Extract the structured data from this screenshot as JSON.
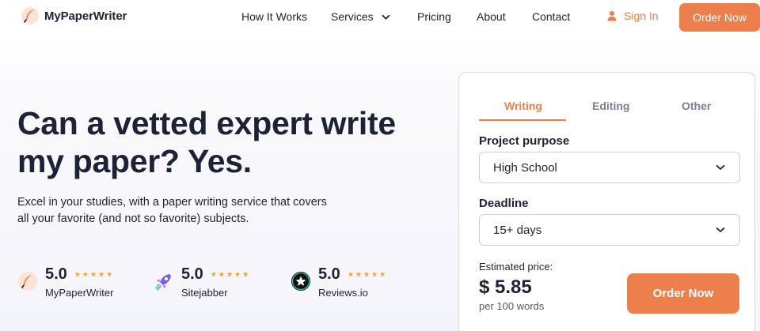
{
  "brand": {
    "name": "MyPaperWriter"
  },
  "nav": {
    "items": [
      {
        "label": "How It Works"
      },
      {
        "label": "Services"
      },
      {
        "label": "Pricing"
      },
      {
        "label": "About"
      },
      {
        "label": "Contact"
      }
    ],
    "signin_label": "Sign In",
    "order_label": "Order Now"
  },
  "hero": {
    "title": "Can a vetted expert write my paper? Yes.",
    "subtitle": "Excel in your studies, with a paper writing service that covers all your favorite (and not so favorite) subjects."
  },
  "ratings": [
    {
      "score": "5.0",
      "stars": 5,
      "name": "MyPaperWriter",
      "icon": "feather-logo-icon"
    },
    {
      "score": "5.0",
      "stars": 5,
      "name": "Sitejabber",
      "icon": "sitejabber-rocket-icon"
    },
    {
      "score": "5.0",
      "stars": 5,
      "name": "Reviews.io",
      "icon": "reviews-io-star-icon"
    }
  ],
  "calculator": {
    "tabs": [
      {
        "label": "Writing",
        "active": true
      },
      {
        "label": "Editing",
        "active": false
      },
      {
        "label": "Other",
        "active": false
      }
    ],
    "purpose_label": "Project purpose",
    "purpose_value": "High School",
    "deadline_label": "Deadline",
    "deadline_value": "15+ days",
    "estimate_label": "Estimated price:",
    "price": "$ 5.85",
    "price_unit": "per 100 words",
    "order_label": "Order Now"
  },
  "colors": {
    "accent": "#ec7f4b",
    "text": "#1e2235",
    "star": "#f2a23a"
  }
}
